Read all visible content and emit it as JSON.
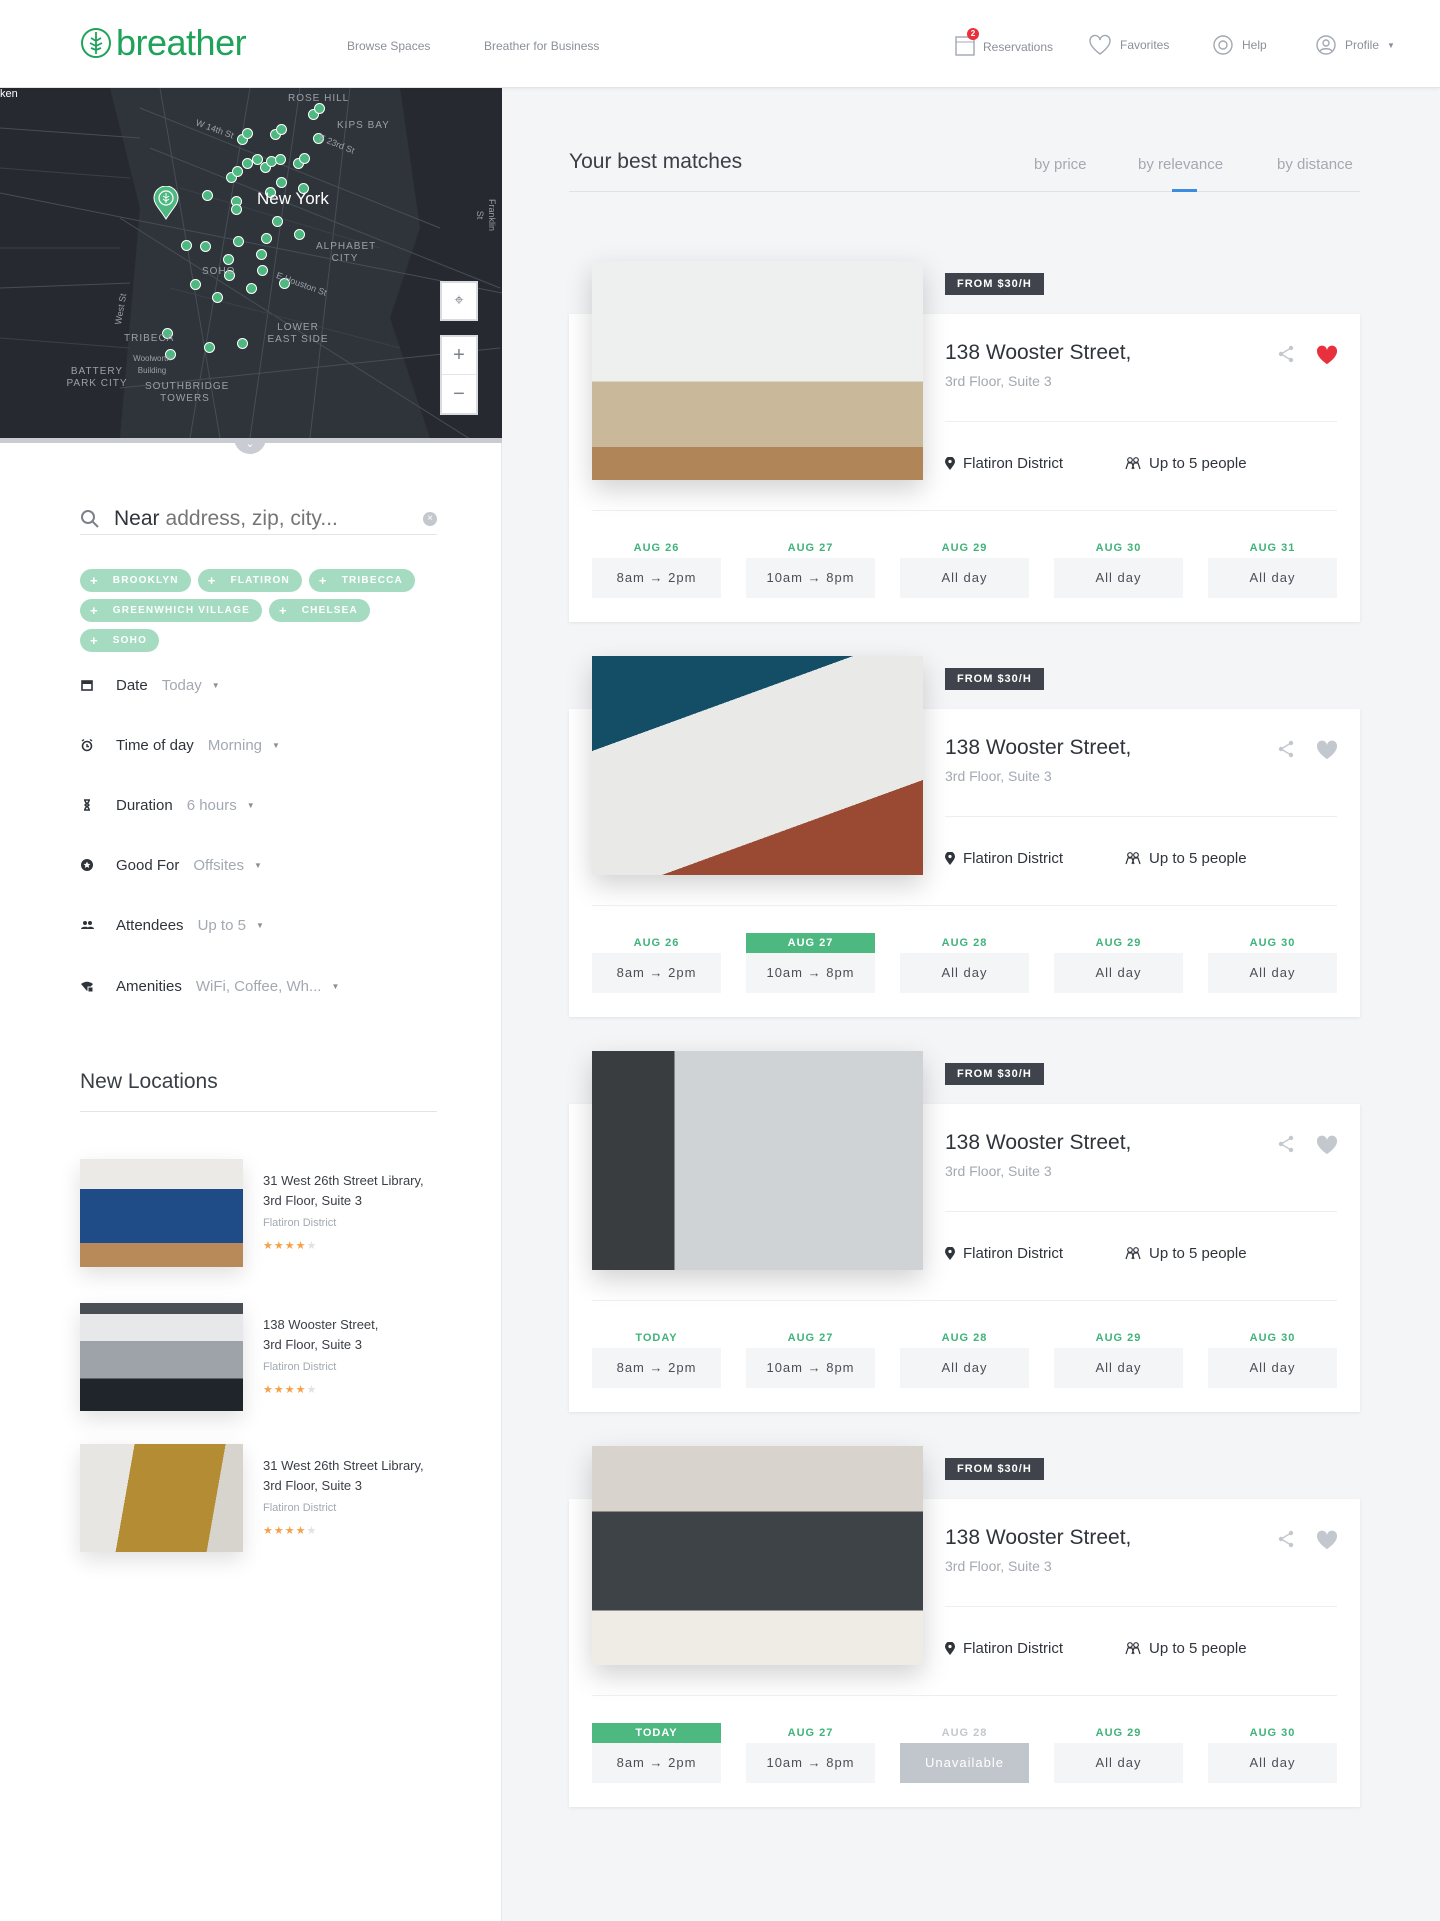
{
  "header": {
    "brand": "breather",
    "nav": [
      "Browse Spaces",
      "Breather for Business"
    ],
    "reservations": {
      "label": "Reservations",
      "count": "2"
    },
    "favorites": "Favorites",
    "help": "Help",
    "profile": "Profile"
  },
  "map": {
    "city_label": "New York",
    "labels": [
      "Rose Hill",
      "Kips Bay",
      "Alphabet City",
      "SoHo",
      "Lower East Side",
      "Tribeca",
      "Battery Park City",
      "Southbridge Towers",
      "Woolworth Building",
      "W 14th St",
      "E 23rd St",
      "E Houston St",
      "West St",
      "Franklin St",
      "ken"
    ],
    "marker_color": "#4db87f"
  },
  "search": {
    "prefix": "Near",
    "placeholder": "address, zip, city..."
  },
  "chips": [
    "BROOKLYN",
    "FLATIRON",
    "TRIBECCA",
    "GREENWHICH VILLAGE",
    "CHELSEA",
    "SOHO"
  ],
  "filters": [
    {
      "icon": "calendar-icon",
      "label": "Date",
      "value": "Today"
    },
    {
      "icon": "alarm-clock-icon",
      "label": "Time of day",
      "value": "Morning"
    },
    {
      "icon": "hourglass-icon",
      "label": "Duration",
      "value": "6 hours"
    },
    {
      "icon": "star-badge-icon",
      "label": "Good For",
      "value": "Offsites"
    },
    {
      "icon": "people-icon",
      "label": "Attendees",
      "value": "Up to 5"
    },
    {
      "icon": "wifi-coffee-icon",
      "label": "Amenities",
      "value": "WiFi, Coffee, Wh..."
    }
  ],
  "new_locations": {
    "title": "New Locations",
    "items": [
      {
        "name": "31 West 26th Street Library,",
        "sub": "3rd Floor, Suite 3",
        "district": "Flatiron District",
        "rating": 4
      },
      {
        "name": "138 Wooster Street,",
        "sub": "3rd Floor, Suite 3",
        "district": "Flatiron District",
        "rating": 4
      },
      {
        "name": "31 West 26th Street Library,",
        "sub": "3rd Floor, Suite 3",
        "district": "Flatiron District",
        "rating": 4
      }
    ]
  },
  "results": {
    "heading": "Your best matches",
    "sort": [
      "by price",
      "by relevance",
      "by distance"
    ],
    "active_sort": "by relevance",
    "cards": [
      {
        "price": "FROM $30/H",
        "title": "138 Wooster Street,",
        "sub": "3rd Floor, Suite 3",
        "district": "Flatiron District",
        "capacity": "Up to 5 people",
        "favorited": true,
        "slots": [
          {
            "date": "AUG 26",
            "time": "8am → 2pm"
          },
          {
            "date": "AUG 27",
            "time": "10am → 8pm"
          },
          {
            "date": "AUG 29",
            "time": "All day"
          },
          {
            "date": "AUG 30",
            "time": "All day"
          },
          {
            "date": "AUG 31",
            "time": "All day"
          }
        ]
      },
      {
        "price": "FROM $30/H",
        "title": "138 Wooster Street,",
        "sub": "3rd Floor, Suite 3",
        "district": "Flatiron District",
        "capacity": "Up to 5 people",
        "favorited": false,
        "slots": [
          {
            "date": "AUG 26",
            "time": "8am → 2pm"
          },
          {
            "date": "AUG 27",
            "time": "10am → 8pm",
            "selected": true
          },
          {
            "date": "AUG 28",
            "time": "All day"
          },
          {
            "date": "AUG 29",
            "time": "All day"
          },
          {
            "date": "AUG 30",
            "time": "All day"
          }
        ]
      },
      {
        "price": "FROM $30/H",
        "title": "138 Wooster Street,",
        "sub": "3rd Floor, Suite 3",
        "district": "Flatiron District",
        "capacity": "Up to 5 people",
        "favorited": false,
        "slots": [
          {
            "date": "TODAY",
            "time": "8am → 2pm"
          },
          {
            "date": "AUG 27",
            "time": "10am → 8pm"
          },
          {
            "date": "AUG 28",
            "time": "All day"
          },
          {
            "date": "AUG 29",
            "time": "All day"
          },
          {
            "date": "AUG 30",
            "time": "All day"
          }
        ]
      },
      {
        "price": "FROM $30/H",
        "title": "138 Wooster Street,",
        "sub": "3rd Floor, Suite 3",
        "district": "Flatiron District",
        "capacity": "Up to 5 people",
        "favorited": false,
        "slots": [
          {
            "date": "TODAY",
            "time": "8am → 2pm",
            "selected": true
          },
          {
            "date": "AUG 27",
            "time": "10am → 8pm"
          },
          {
            "date": "AUG 28",
            "time": "Unavailable",
            "unavailable": true
          },
          {
            "date": "AUG 29",
            "time": "All day"
          },
          {
            "date": "AUG 30",
            "time": "All day"
          }
        ]
      }
    ]
  },
  "colors": {
    "brand": "#1fa35b",
    "accent_green": "#4db87f",
    "chip": "#a5dcc1",
    "heart": "#e8313c",
    "sort_underline": "#3c8de0",
    "star": "#f5a04a"
  }
}
